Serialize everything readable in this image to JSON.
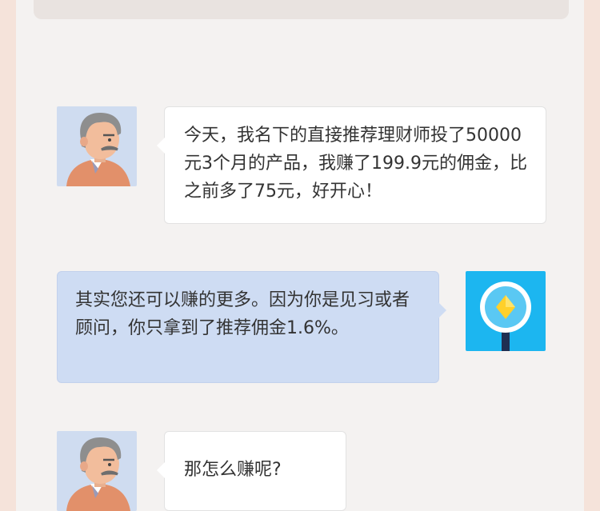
{
  "messages": [
    {
      "sender": "user",
      "text": "今天，我名下的直接推荐理财师投了50000元3个月的产品，我赚了199.9元的佣金，比之前多了75元，好开心！"
    },
    {
      "sender": "advisor",
      "text": "其实您还可以赚的更多。因为你是见习或者顾问，你只拿到了推荐佣金1.6%。"
    },
    {
      "sender": "user",
      "text": "那怎么赚呢?"
    }
  ],
  "colors": {
    "page_background": "#f5e3da",
    "panel_background": "#f4f2f1",
    "user_bubble": "#ffffff",
    "advisor_bubble": "#cedcf3",
    "advisor_avatar": "#1cb6f0"
  },
  "icons": {
    "user_avatar": "elderly-man-avatar-icon",
    "advisor_avatar": "magnifier-diamond-icon"
  }
}
